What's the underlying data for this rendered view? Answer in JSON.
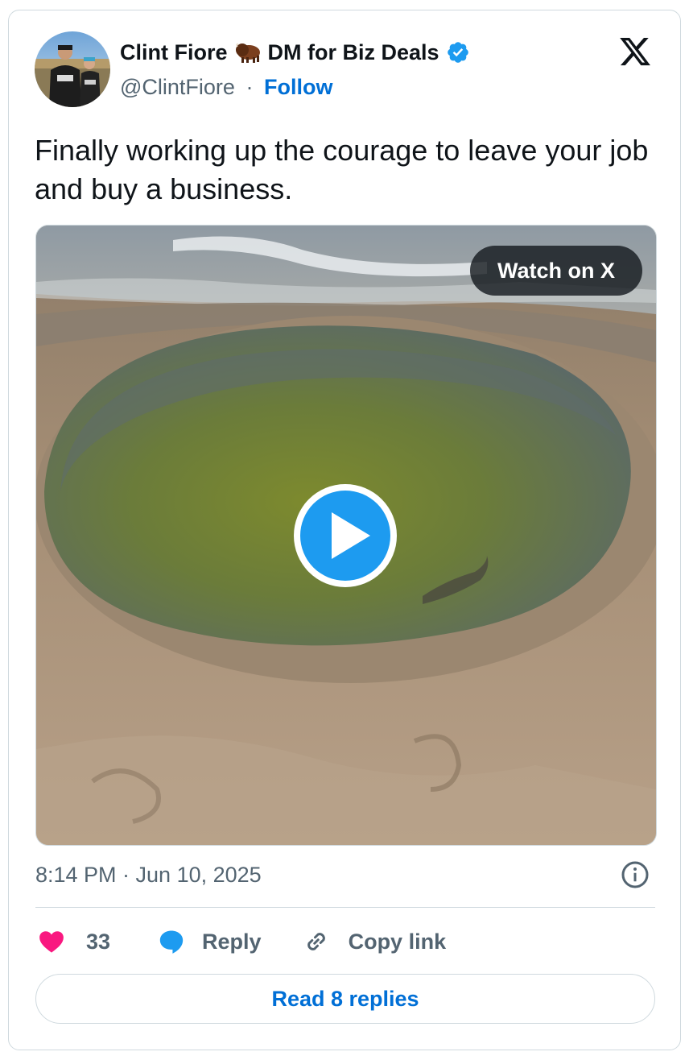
{
  "author": {
    "name": "Clint Fiore",
    "name_suffix": "DM for Biz Deals",
    "handle": "@ClintFiore",
    "separator": "·",
    "follow_label": "Follow"
  },
  "tweet": {
    "text": "Finally working up the courage to leave your job and buy a business.",
    "timestamp": "8:14 PM · Jun 10, 2025"
  },
  "media": {
    "watch_label": "Watch on X"
  },
  "actions": {
    "like_count": "33",
    "reply_label": "Reply",
    "copy_label": "Copy link"
  },
  "footer": {
    "read_replies_label": "Read 8 replies"
  },
  "colors": {
    "link_blue": "#006fd6",
    "verified_blue": "#1d9bf0",
    "heart_pink": "#f91880",
    "muted_text": "#536471",
    "border": "#cfd9de"
  },
  "icons": [
    "x-logo-icon",
    "bison-icon",
    "verified-badge-icon",
    "play-icon",
    "info-icon",
    "heart-icon",
    "reply-bubble-icon",
    "link-icon"
  ]
}
